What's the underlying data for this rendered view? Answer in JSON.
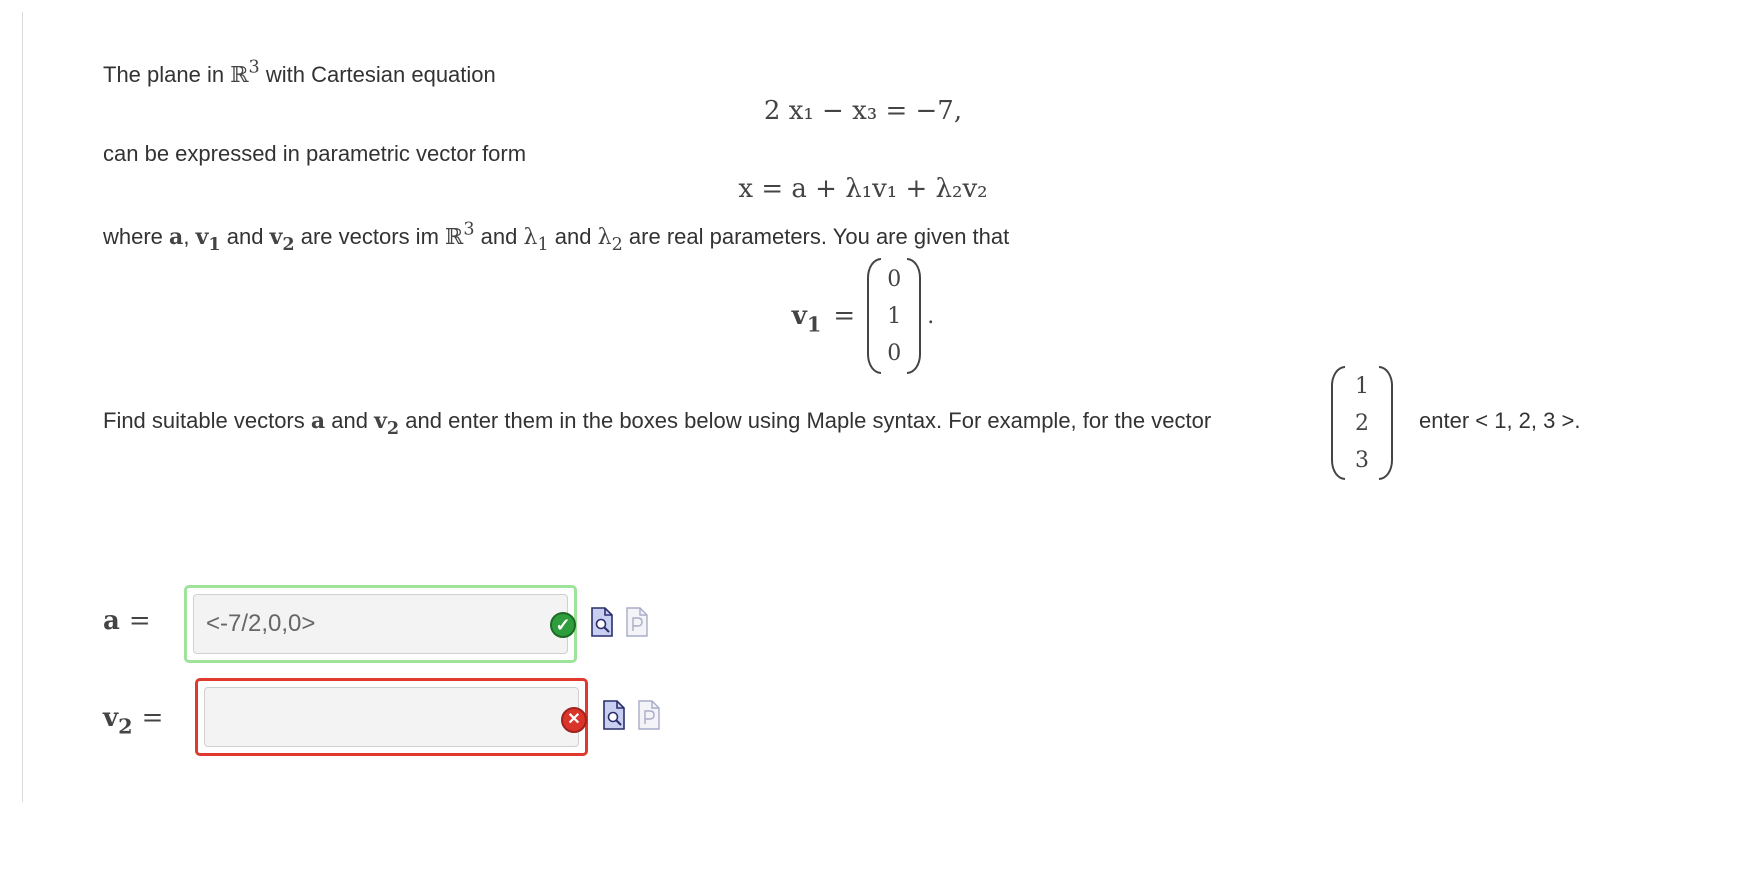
{
  "intro": {
    "line1_prefix": "The plane in",
    "line1_set": "ℝ",
    "line1_exp": "3",
    "line1_suffix": "with Cartesian equation",
    "equation": "2 x₁ − x₃ = −7,",
    "line2": "can be expressed in parametric vector form",
    "param_form": "x = a + λ₁v₁ + λ₂v₂",
    "line3": {
      "where": "where",
      "a": "a",
      "comma": ",",
      "v1": "v",
      "v1_sub": "1",
      "and1": "and",
      "v2": "v",
      "v2_sub": "2",
      "mid": "are vectors im",
      "set": "ℝ",
      "exp": "3",
      "and2": "and",
      "l1": "λ",
      "l1_sub": "1",
      "and3": "and",
      "l2": "λ",
      "l2_sub": "2",
      "tail": "are real parameters.  You are given that"
    },
    "v1_label": "v",
    "v1_label_sub": "1",
    "v1_eq": "=",
    "v1_entries": [
      "0",
      "1",
      "0"
    ],
    "v1_period": "."
  },
  "instruction": {
    "prefix": "Find suitable vectors",
    "a": "a",
    "and": "and",
    "v2": "v",
    "v2_sub": "2",
    "mid": "and enter them in the boxes below using Maple syntax.  For example, for the vector",
    "example_entries": [
      "1",
      "2",
      "3"
    ],
    "suffix": "enter < 1, 2, 3 >."
  },
  "answers": {
    "a": {
      "label": "a",
      "eq": "=",
      "value": "<-7/2,0,0>",
      "status": "correct"
    },
    "v2": {
      "label": "v",
      "label_sub": "2",
      "eq": "=",
      "value": "",
      "status": "incorrect"
    }
  },
  "icons": {
    "correct": "check-icon",
    "incorrect": "cross-icon",
    "preview": "preview-doc-icon",
    "plot": "document-icon"
  },
  "colors": {
    "correct_border": "#9ee39a",
    "incorrect_border": "#e03a2e",
    "correct_icon": "#2e9d3c",
    "incorrect_icon": "#d9352b"
  }
}
